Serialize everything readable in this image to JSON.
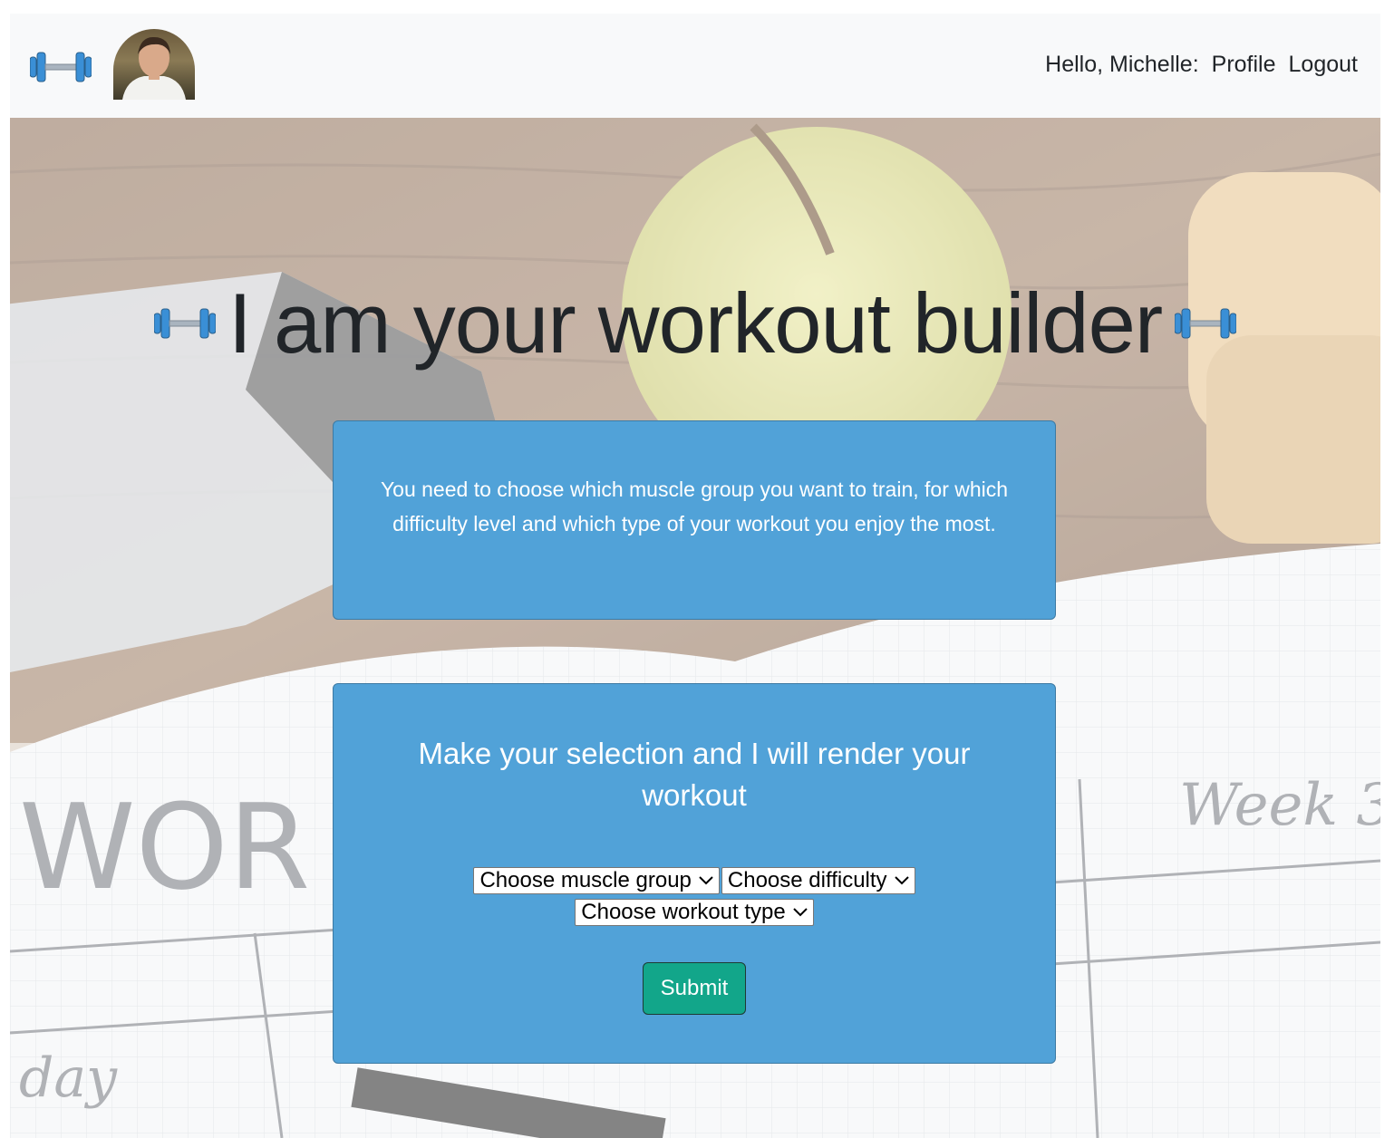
{
  "navbar": {
    "logo_icon": "dumbbell-icon",
    "avatar_icon": "user-avatar",
    "greeting": "Hello, Michelle:",
    "profile_link": "Profile",
    "logout_link": "Logout"
  },
  "hero": {
    "title": "I am your workout builder",
    "title_icon": "dumbbell-icon",
    "background_word_1": "WOR",
    "background_word_2": "Week 3",
    "background_word_3": "day"
  },
  "info_card": {
    "text": "You need to choose which muscle group you want to train, for which difficulty level and which type of your workout you enjoy the most."
  },
  "form_card": {
    "heading": "Make your selection and I will render your workout",
    "muscle_select": "Choose muscle group",
    "difficulty_select": "Choose difficulty",
    "workout_type_select": "Choose workout type",
    "submit_label": "Submit"
  },
  "colors": {
    "accent": "#51a2d8",
    "submit": "#12a68a",
    "navbar": "#f8f9fa",
    "icon_blue": "#3a8fd6"
  }
}
